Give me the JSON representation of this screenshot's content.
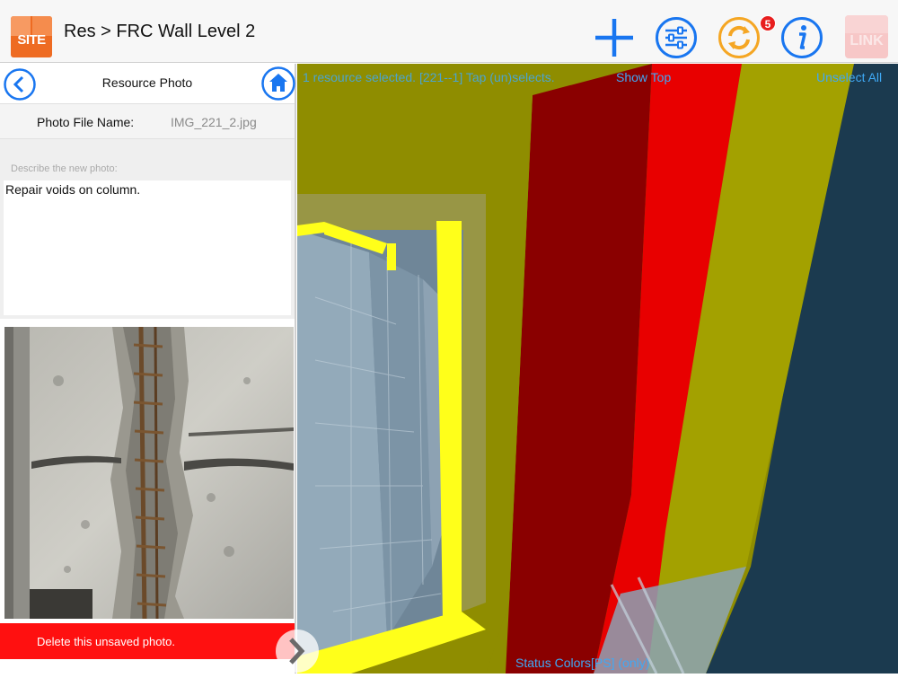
{
  "app": {
    "logo_text": "SITE",
    "breadcrumb": "Res > FRC Wall Level 2"
  },
  "toolbar": {
    "add_icon": "plus-icon",
    "filter_icon": "sliders-icon",
    "sync_icon": "sync-icon",
    "sync_badge": "5",
    "info_icon": "info-icon",
    "link_label": "LINK",
    "colors": {
      "blue": "#1976f0",
      "orange": "#f5a623"
    }
  },
  "panel": {
    "title": "Resource Photo",
    "back_icon": "chevron-left-icon",
    "home_icon": "home-icon",
    "file_name_label": "Photo File Name:",
    "file_name_value": "IMG_221_2.jpg",
    "describe_label": "Describe the new photo:",
    "description": "Repair voids on column.",
    "delete_label": "Delete this unsaved photo.",
    "delete_color": "#ff1010"
  },
  "view3d": {
    "selection_text": "1 resource selected. [221--1] Tap (un)selects.",
    "show_top": "Show Top",
    "unselect_all": "Unselect All",
    "status_colors": "Status Colors[PS] (only)",
    "colors": {
      "olive": "#8f8d00",
      "red": "#e80000",
      "dark_red": "#8a0000",
      "yellow": "#ffff1a",
      "navy": "#1b3a4f",
      "steel": "#8ba2b5"
    }
  }
}
